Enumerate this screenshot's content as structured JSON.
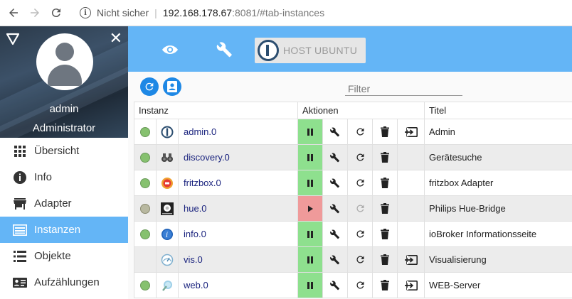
{
  "browser": {
    "security_label": "Nicht sicher",
    "url_host": "192.168.178.67",
    "url_rest": ":8081/#tab-instances"
  },
  "sidebar": {
    "user_name": "admin",
    "user_role": "Administrator",
    "items": [
      {
        "label": "Übersicht",
        "icon": "grid-icon",
        "active": false
      },
      {
        "label": "Info",
        "icon": "info-icon",
        "active": false
      },
      {
        "label": "Adapter",
        "icon": "store-icon",
        "active": false
      },
      {
        "label": "Instanzen",
        "icon": "instances-icon",
        "active": true
      },
      {
        "label": "Objekte",
        "icon": "list-icon",
        "active": false
      },
      {
        "label": "Aufzählungen",
        "icon": "enum-icon",
        "active": false
      }
    ]
  },
  "topbar": {
    "host_label": "HOST UBUNTU"
  },
  "toolbar": {
    "filter_placeholder": "Filter"
  },
  "table": {
    "headers": {
      "instance": "Instanz",
      "actions": "Aktionen",
      "title": "Titel"
    },
    "rows": [
      {
        "name": "admin.0",
        "title": "Admin",
        "status": "green",
        "running": true,
        "icon": "iobroker-logo-icon",
        "has_link": true
      },
      {
        "name": "discovery.0",
        "title": "Gerätesuche",
        "status": "green",
        "running": true,
        "icon": "binoculars-icon",
        "has_link": false
      },
      {
        "name": "fritzbox.0",
        "title": "fritzbox Adapter",
        "status": "green",
        "running": true,
        "icon": "fritzbox-icon",
        "has_link": false
      },
      {
        "name": "hue.0",
        "title": "Philips Hue-Bridge",
        "status": "grey",
        "running": false,
        "icon": "hue-bridge-icon",
        "has_link": false
      },
      {
        "name": "info.0",
        "title": "ioBroker Informationsseite",
        "status": "green",
        "running": true,
        "icon": "info-adapter-icon",
        "has_link": false
      },
      {
        "name": "vis.0",
        "title": "Visualisierung",
        "status": "none",
        "running": true,
        "icon": "gauge-icon",
        "has_link": true
      },
      {
        "name": "web.0",
        "title": "WEB-Server",
        "status": "green",
        "running": true,
        "icon": "web-globe-icon",
        "has_link": true
      }
    ]
  },
  "colors": {
    "accent": "#64b5f6",
    "button_blue": "#1e88e5",
    "running": "#8ee08e",
    "stopped": "#ef9a9a",
    "status_green": "#86c16f"
  }
}
